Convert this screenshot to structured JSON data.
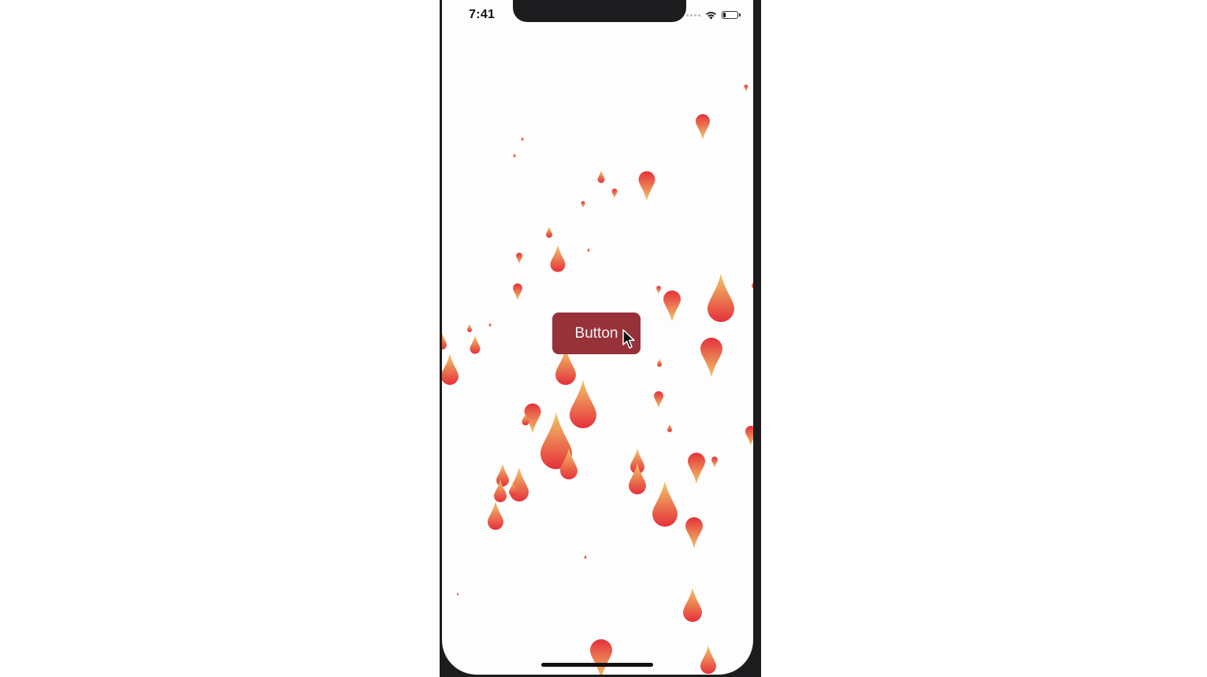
{
  "status_bar": {
    "time": "7:41",
    "icons": [
      "cellular-dots-icon",
      "wifi-icon",
      "battery-icon"
    ],
    "battery_level": 0.2
  },
  "main": {
    "button_label": "Button"
  },
  "theme": {
    "button_color": "#97323a",
    "drop_color_top": "#f2c868",
    "drop_color_bottom": "#e5303b",
    "phone_frame": "#1c1c1e"
  },
  "icons": {
    "cursor": "mouse-pointer-icon",
    "drop": "flame-drop-icon"
  }
}
